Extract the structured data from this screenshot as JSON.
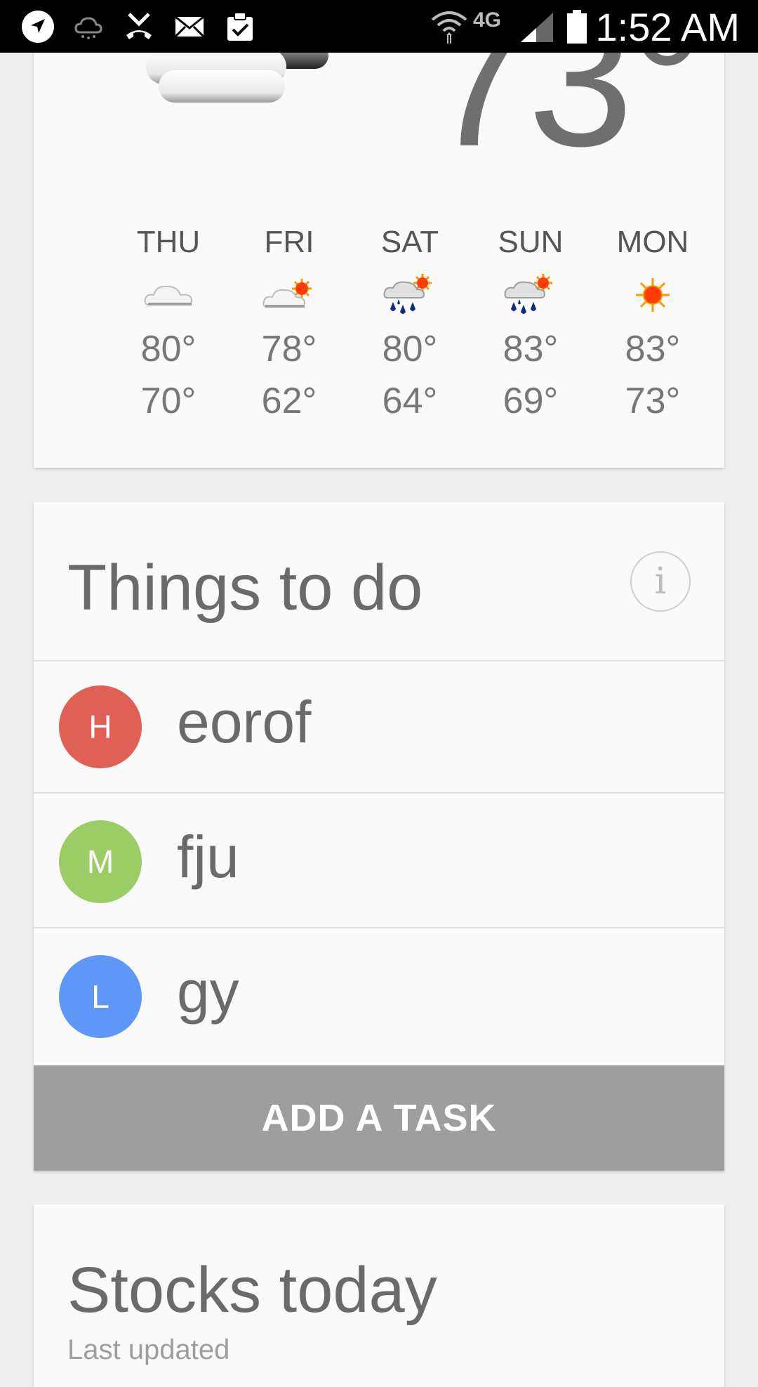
{
  "status_bar": {
    "time": "1:52 AM",
    "network": "4G",
    "icons": [
      "navigation-icon",
      "cloud-icon",
      "missed-call-icon",
      "mail-icon",
      "clipboard-check-icon",
      "wifi-icon",
      "signal-icon",
      "battery-icon"
    ]
  },
  "weather": {
    "current_temp": "73°",
    "current_icon": "cloudy-icon",
    "forecast": [
      {
        "day": "THU",
        "icon": "cloud-icon",
        "hi": "80°",
        "lo": "70°"
      },
      {
        "day": "FRI",
        "icon": "partly-sunny-icon",
        "hi": "78°",
        "lo": "62°"
      },
      {
        "day": "SAT",
        "icon": "rain-sun-icon",
        "hi": "80°",
        "lo": "64°"
      },
      {
        "day": "SUN",
        "icon": "rain-sun-icon",
        "hi": "83°",
        "lo": "69°"
      },
      {
        "day": "MON",
        "icon": "sun-icon",
        "hi": "83°",
        "lo": "73°"
      }
    ]
  },
  "todo": {
    "title": "Things to do",
    "info_label": "i",
    "tasks": [
      {
        "initial": "H",
        "text": "eorof",
        "color": "#e06055"
      },
      {
        "initial": "M",
        "text": "fju",
        "color": "#9ccc65"
      },
      {
        "initial": "L",
        "text": "gy",
        "color": "#5e97f6"
      }
    ],
    "add_label": "ADD A TASK"
  },
  "stocks": {
    "title": "Stocks today",
    "subtitle": "Last updated"
  }
}
